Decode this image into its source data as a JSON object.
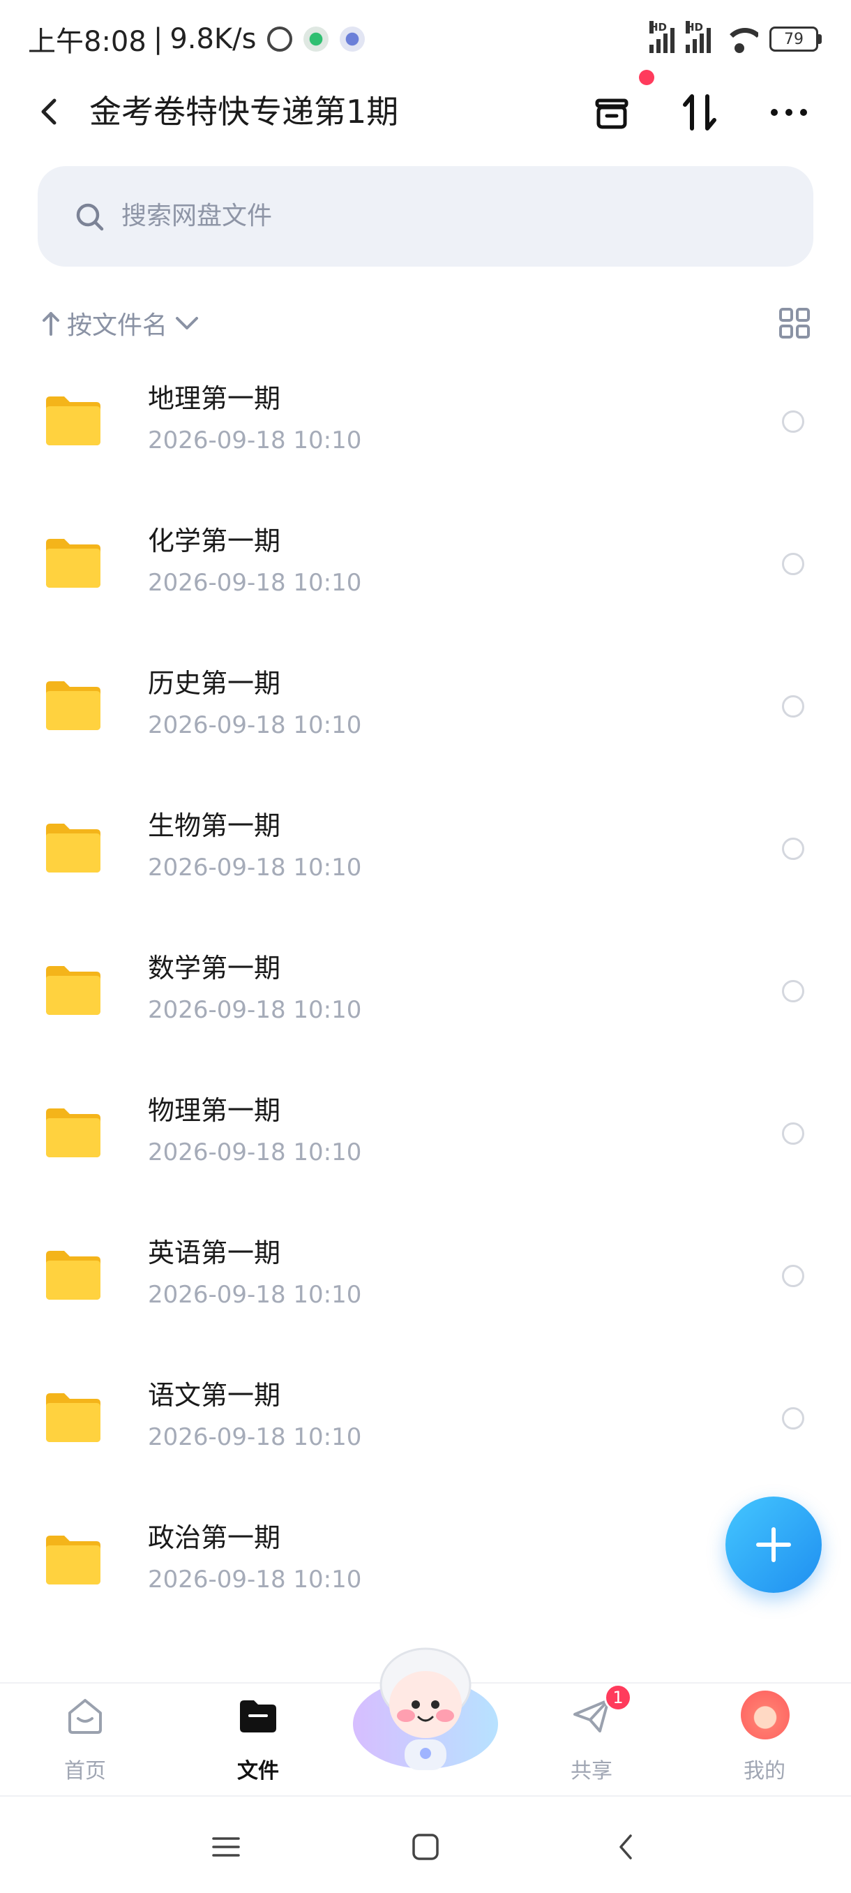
{
  "status_bar": {
    "time": "上午8:08",
    "separator": "|",
    "speed": "9.8K/s",
    "battery": "79",
    "signal_label": "HD"
  },
  "header": {
    "title": "金考卷特快专递第1期",
    "has_notification_dot": true
  },
  "search": {
    "placeholder": "搜索网盘文件"
  },
  "sort": {
    "label": "按文件名"
  },
  "files": [
    {
      "name": "地理第一期",
      "date": "2026-09-18  10:10",
      "icon": "folder-icon"
    },
    {
      "name": "化学第一期",
      "date": "2026-09-18  10:10",
      "icon": "folder-icon"
    },
    {
      "name": "历史第一期",
      "date": "2026-09-18  10:10",
      "icon": "folder-icon"
    },
    {
      "name": "生物第一期",
      "date": "2026-09-18  10:10",
      "icon": "folder-icon"
    },
    {
      "name": "数学第一期",
      "date": "2026-09-18  10:10",
      "icon": "folder-icon"
    },
    {
      "name": "物理第一期",
      "date": "2026-09-18  10:10",
      "icon": "folder-icon"
    },
    {
      "name": "英语第一期",
      "date": "2026-09-18  10:10",
      "icon": "folder-icon"
    },
    {
      "name": "语文第一期",
      "date": "2026-09-18  10:10",
      "icon": "folder-icon"
    },
    {
      "name": "政治第一期",
      "date": "2026-09-18  10:10",
      "icon": "folder-icon"
    }
  ],
  "tab_bar": {
    "home": "首页",
    "files": "文件",
    "share": "共享",
    "share_badge": "1",
    "me": "我的",
    "active": "files"
  },
  "colors": {
    "accent": "#1f8ff0",
    "badge": "#ff3b5c",
    "folder": "#ffc928",
    "search_bg": "#eef1f7"
  }
}
